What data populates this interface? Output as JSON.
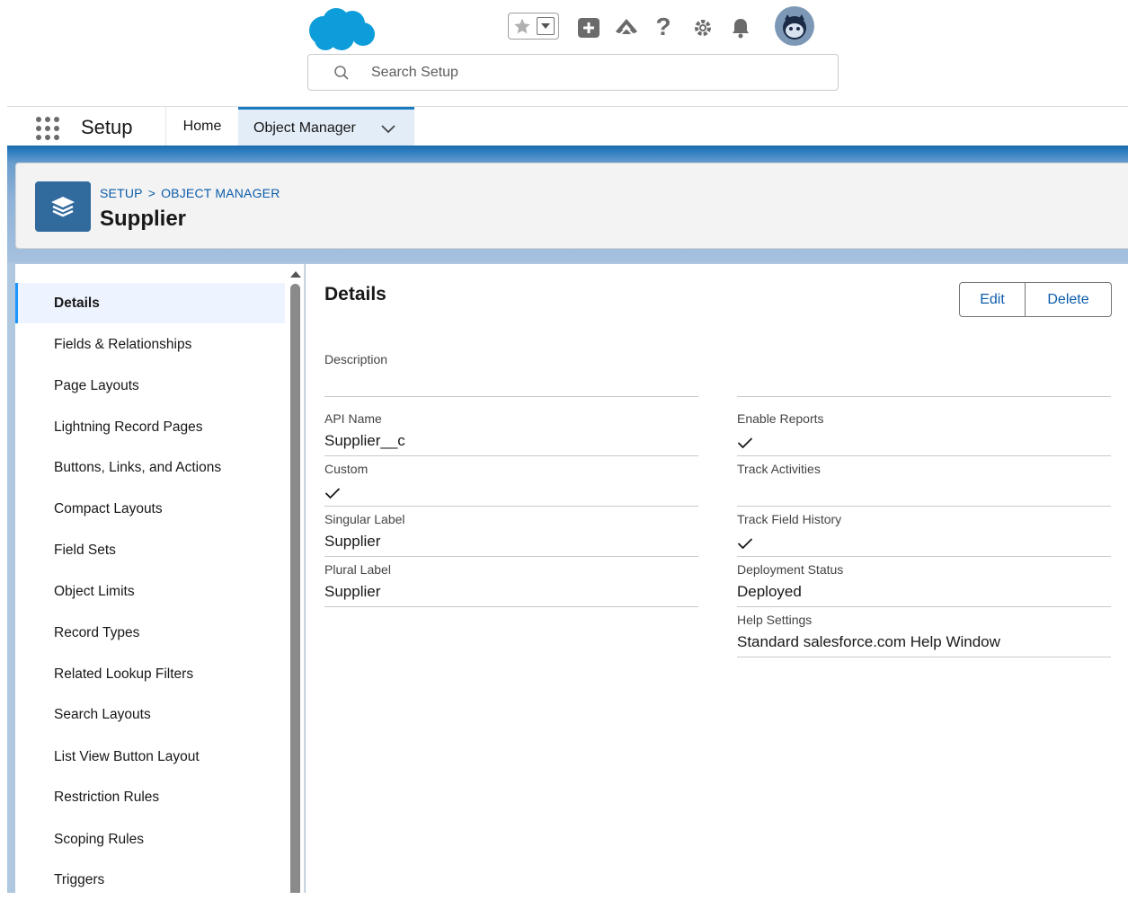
{
  "header": {
    "search_placeholder": "Search Setup",
    "icons": [
      "salesforce-cloud-logo",
      "favorites-star-icon",
      "favorites-dropdown-icon",
      "global-actions-icon",
      "trailhead-icon",
      "help-icon",
      "setup-gear-icon",
      "notifications-bell-icon",
      "user-avatar"
    ]
  },
  "nav": {
    "app_name": "Setup",
    "home": "Home",
    "object_manager": "Object Manager"
  },
  "object": {
    "breadcrumb_setup": "SETUP",
    "breadcrumb_sep": ">",
    "breadcrumb_om": "OBJECT MANAGER",
    "title": "Supplier"
  },
  "sidebar": {
    "items": [
      {
        "label": "Details",
        "active": true
      },
      {
        "label": "Fields & Relationships"
      },
      {
        "label": "Page Layouts"
      },
      {
        "label": "Lightning Record Pages"
      },
      {
        "label": "Buttons, Links, and Actions"
      },
      {
        "label": "Compact Layouts"
      },
      {
        "label": "Field Sets"
      },
      {
        "label": "Object Limits"
      },
      {
        "label": "Record Types"
      },
      {
        "label": "Related Lookup Filters"
      },
      {
        "label": "Search Layouts"
      },
      {
        "label": "List View Button Layout"
      },
      {
        "label": "Restriction Rules"
      },
      {
        "label": "Scoping Rules"
      },
      {
        "label": "Triggers"
      }
    ]
  },
  "details": {
    "title": "Details",
    "edit_label": "Edit",
    "delete_label": "Delete",
    "description_label": "Description",
    "left": [
      {
        "label": "API Name",
        "value": "Supplier__c"
      },
      {
        "label": "Custom",
        "checked": true
      },
      {
        "label": "Singular Label",
        "value": "Supplier"
      },
      {
        "label": "Plural Label",
        "value": "Supplier"
      }
    ],
    "right": [
      {
        "label": "Enable Reports",
        "checked": true
      },
      {
        "label": "Track Activities",
        "checked": false
      },
      {
        "label": "Track Field History",
        "checked": true
      },
      {
        "label": "Deployment Status",
        "value": "Deployed"
      },
      {
        "label": "Help Settings",
        "value": "Standard salesforce.com Help Window"
      }
    ]
  },
  "colors": {
    "accent": "#0b5cab",
    "active_tab_bg": "#e3edf7",
    "object_icon_bg": "#316a9c",
    "band": "#b0c7e0"
  }
}
